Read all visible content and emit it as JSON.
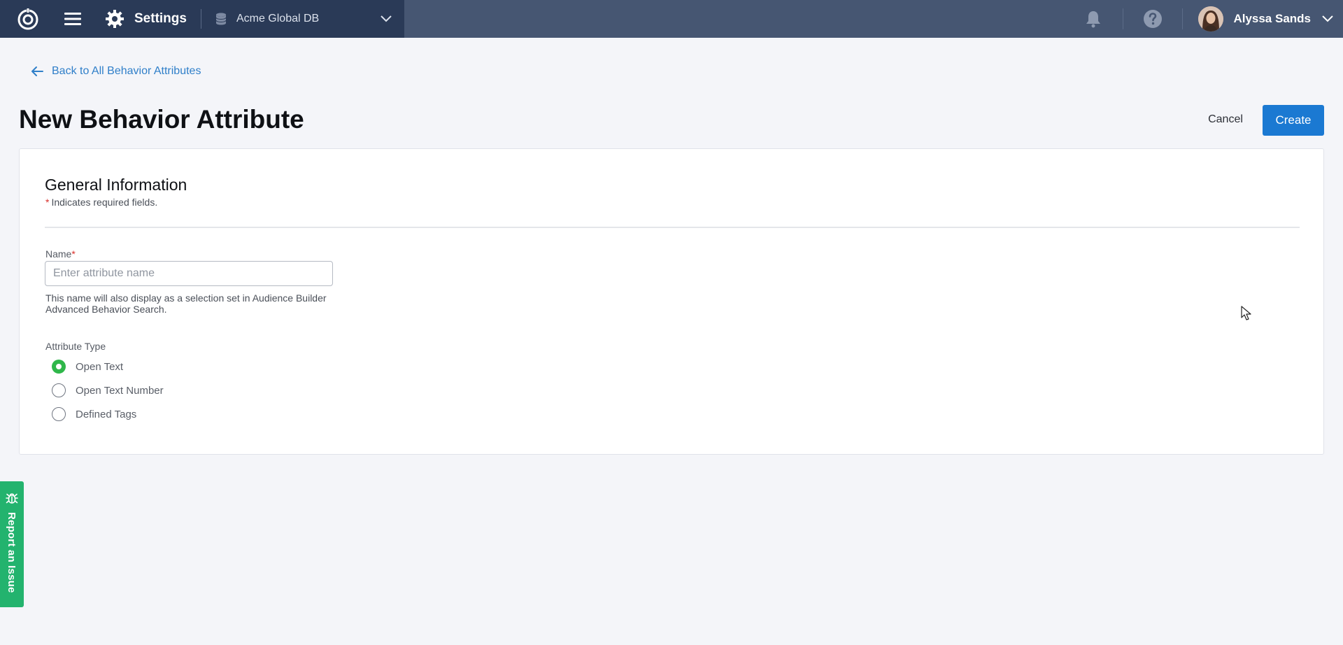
{
  "header": {
    "section_label": "Settings",
    "database_name": "Acme Global DB",
    "user_name": "Alyssa Sands",
    "icons": {
      "logo": "brand-logo-icon",
      "menu": "hamburger-menu-icon",
      "settings": "gear-icon",
      "database": "database-icon",
      "dropdown": "chevron-down-icon",
      "notifications": "bell-icon",
      "help": "help-icon"
    },
    "colors": {
      "bar": "#465672",
      "left_zone": "#2a3a57"
    }
  },
  "nav": {
    "back_label": "Back to All Behavior Attributes"
  },
  "page": {
    "title": "New Behavior Attribute",
    "cancel_label": "Cancel",
    "create_label": "Create"
  },
  "form": {
    "section_title": "General Information",
    "required_star": "*",
    "required_note": "Indicates required fields.",
    "name_label": "Name",
    "name_placeholder": "Enter attribute name",
    "name_value": "",
    "name_help": "This name will also display as a selection set in Audience Builder Advanced Behavior Search.",
    "type_label": "Attribute Type",
    "types": [
      {
        "label": "Open Text",
        "selected": true
      },
      {
        "label": "Open Text Number",
        "selected": false
      },
      {
        "label": "Defined Tags",
        "selected": false
      }
    ]
  },
  "report": {
    "label": "Report an Issue",
    "icon": "bug-icon"
  },
  "colors": {
    "primary": "#1b79d2",
    "link": "#2f7fc9",
    "success": "#2fb74a",
    "report_tab": "#23b36e",
    "required": "#d9302b"
  }
}
